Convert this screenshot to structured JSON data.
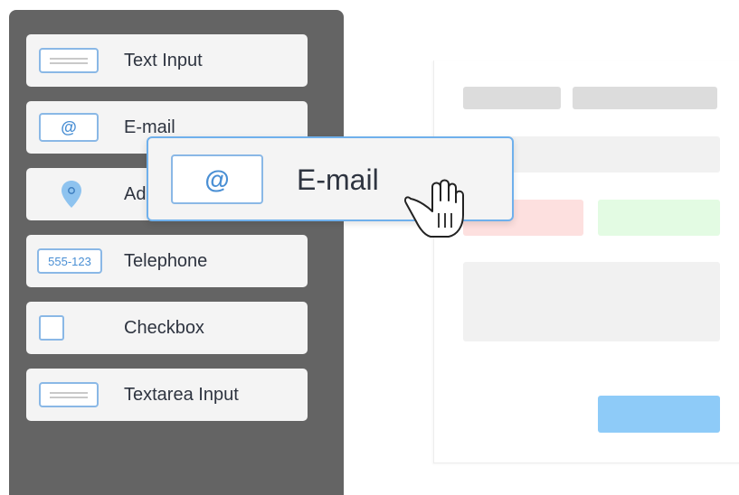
{
  "palette": {
    "items": [
      {
        "label": "Text Input",
        "icon": "text-input-icon"
      },
      {
        "label": "E-mail",
        "icon": "at-sign-icon",
        "icon_text": "@"
      },
      {
        "label": "Address",
        "icon": "map-pin-icon"
      },
      {
        "label": "Telephone",
        "icon": "phone-field-icon",
        "icon_text": "555-123"
      },
      {
        "label": "Checkbox",
        "icon": "checkbox-icon"
      },
      {
        "label": "Textarea Input",
        "icon": "textarea-icon"
      }
    ]
  },
  "drag": {
    "label": "E-mail",
    "icon_text": "@",
    "cursor": "grab-hand-cursor"
  },
  "colors": {
    "sidebar": "#646464",
    "accent": "#6fb0ec",
    "button": "#8ecbf8"
  }
}
